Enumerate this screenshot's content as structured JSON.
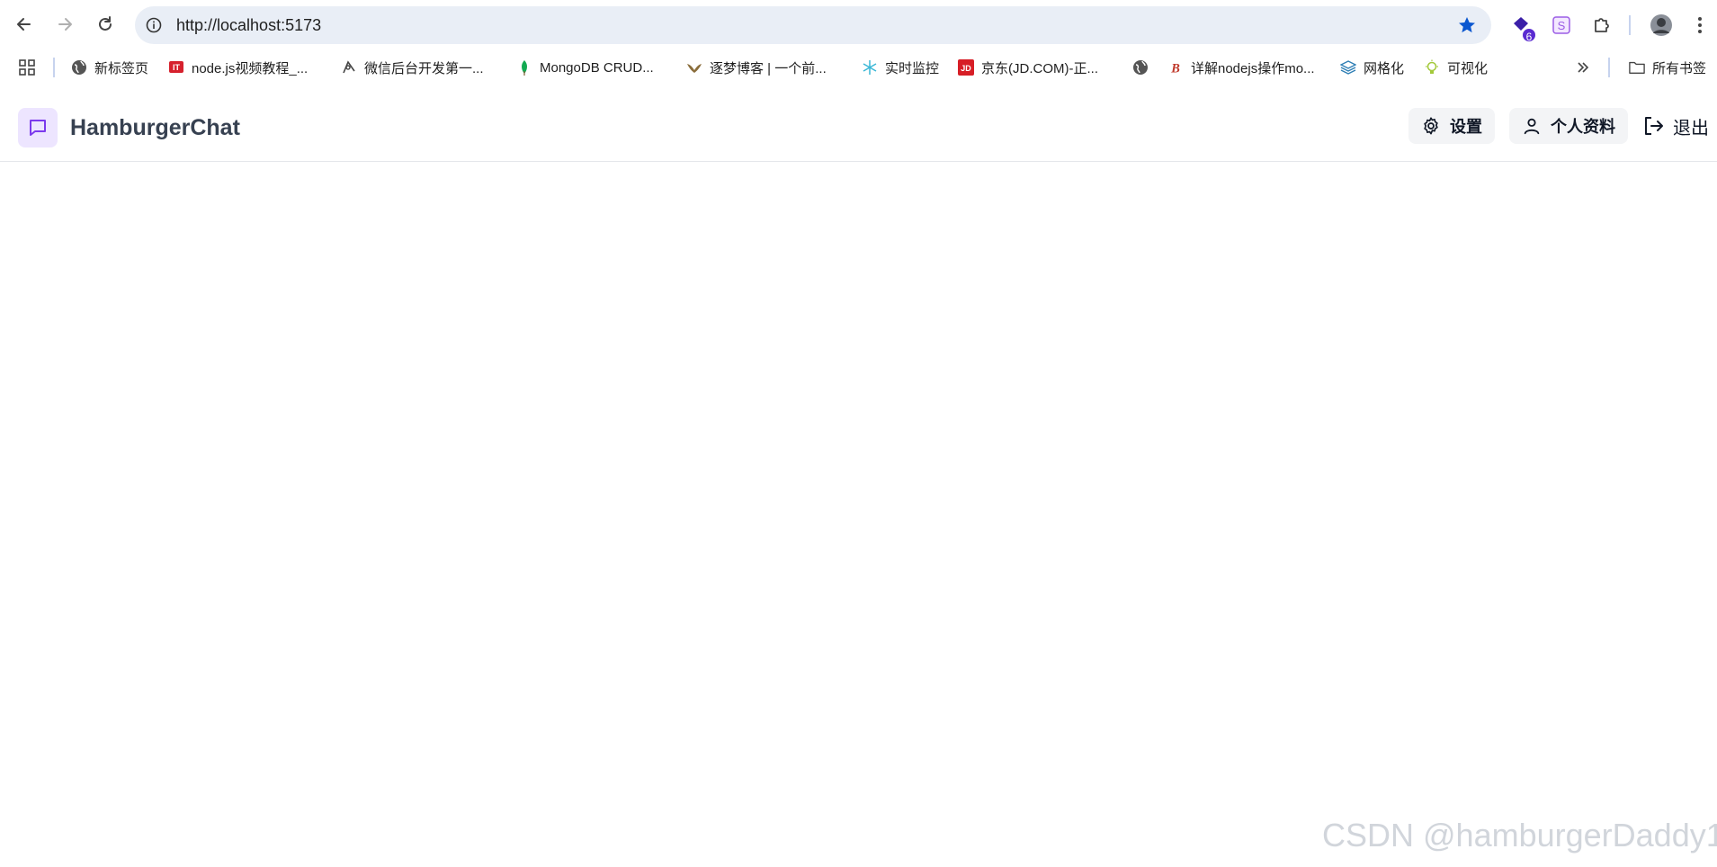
{
  "browser": {
    "url": "http://localhost:5173",
    "extension_badge": "6",
    "bookmarks": [
      {
        "label": "新标签页",
        "icon": "globe-icon"
      },
      {
        "label": "node.js视频教程_...",
        "icon": "it-logo-icon"
      },
      {
        "label": "微信后台开发第一...",
        "icon": "pen-icon"
      },
      {
        "label": "MongoDB CRUD...",
        "icon": "leaf-icon"
      },
      {
        "label": "逐梦博客 | 一个前...",
        "icon": "bird-icon"
      },
      {
        "label": "实时监控",
        "icon": "snowflake-icon"
      },
      {
        "label": "京东(JD.COM)-正...",
        "icon": "jd-logo-icon"
      },
      {
        "label": "",
        "icon": "globe-icon"
      },
      {
        "label": "详解nodejs操作mo...",
        "icon": "b-logo-icon"
      },
      {
        "label": "网格化",
        "icon": "layers-icon"
      },
      {
        "label": "可视化",
        "icon": "bulb-icon"
      }
    ],
    "all_bookmarks_label": "所有书签"
  },
  "app": {
    "title": "HamburgerChat",
    "settings_label": "设置",
    "profile_label": "个人资料",
    "logout_label": "退出",
    "accent_color": "#7c3aed"
  },
  "watermark": "CSDN @hamburgerDaddy1"
}
